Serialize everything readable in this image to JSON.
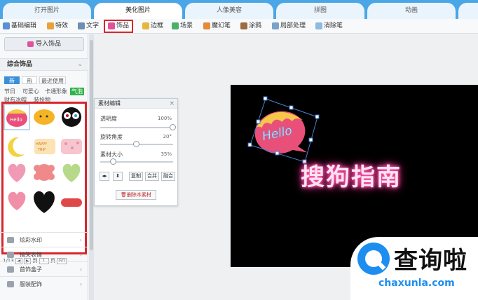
{
  "tabs": [
    "打开图片",
    "美化图片",
    "人像美容",
    "拼图",
    "动画"
  ],
  "toolbar": [
    {
      "label": "基础编辑",
      "icon": "edit-icon"
    },
    {
      "label": "特效",
      "icon": "magic-wand-icon"
    },
    {
      "label": "文字",
      "icon": "text-icon"
    },
    {
      "label": "饰品",
      "icon": "bow-icon"
    },
    {
      "label": "边框",
      "icon": "frame-icon"
    },
    {
      "label": "场景",
      "icon": "scene-icon"
    },
    {
      "label": "魔幻笔",
      "icon": "magic-pen-icon"
    },
    {
      "label": "涂鸦",
      "icon": "brush-icon"
    },
    {
      "label": "局部处理",
      "icon": "local-adjust-icon"
    },
    {
      "label": "消除笔",
      "icon": "eraser-icon"
    }
  ],
  "left_panel": {
    "import_label": "导入饰品",
    "section_title": "综合饰品",
    "filters": [
      "新",
      "热",
      "最近使用"
    ],
    "categories": [
      "节日",
      "可爱心",
      "卡通形象",
      "气泡",
      "财布冰帽",
      "装扮物"
    ],
    "pager": {
      "page": "1/13",
      "goto_label": "到",
      "page_input": "1",
      "page_unit": "页",
      "go_label": "GO"
    },
    "category_list": [
      "炫彩水印",
      "搞笑表情",
      "首饰盒子",
      "服装配饰"
    ]
  },
  "dialog": {
    "title": "素材编辑",
    "close": "×",
    "sliders": [
      {
        "label": "透明度",
        "value": "100%",
        "level": 1.0
      },
      {
        "label": "旋转角度",
        "value": "20°",
        "level": 0.5
      },
      {
        "label": "素材大小",
        "value": "35%",
        "level": 0.18
      }
    ],
    "buttons": [
      "复制",
      "合并",
      "融合"
    ],
    "delete_label": "删除本素材"
  },
  "canvas": {
    "sticker_text": "Hello",
    "neon_text": "搜狗指南"
  },
  "watermark": {
    "brand_text": "查询啦",
    "url": "chaxunla.com"
  },
  "colors": {
    "tab_bar": "#4aa6e6",
    "highlight_red": "#d8262a",
    "neon_pink": "#ff4fa8",
    "brand_blue": "#1d8ef0"
  }
}
